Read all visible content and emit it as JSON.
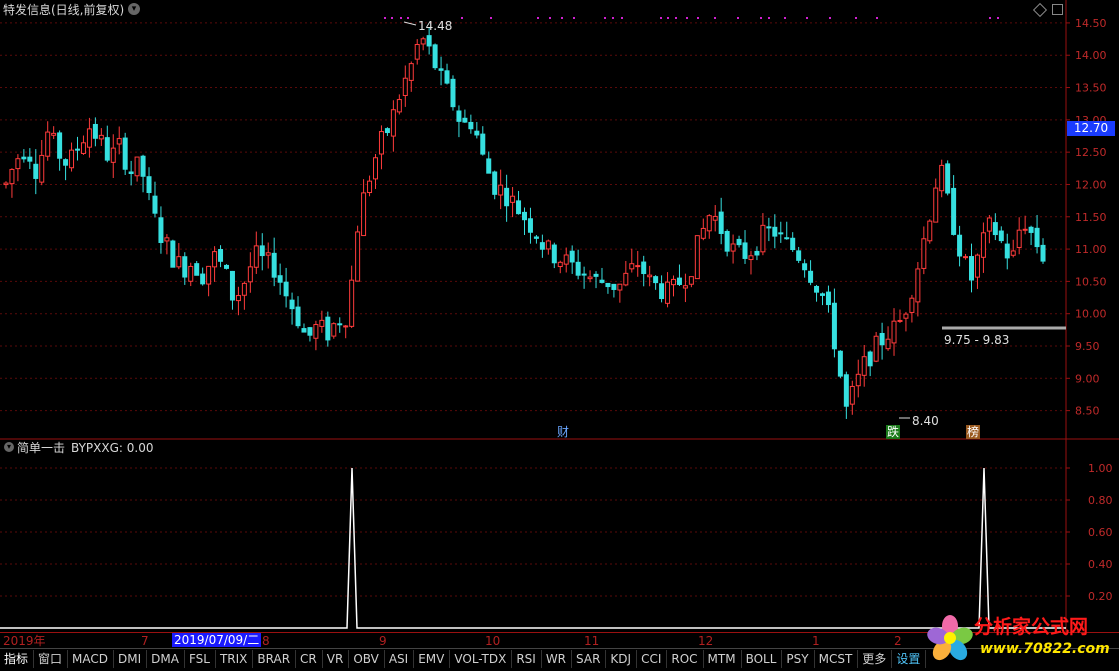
{
  "header": {
    "title": "特发信息(日线,前复权)",
    "mode_icon": "chevron-down-icon"
  },
  "corner_icons": [
    "diamond-icon",
    "square-icon"
  ],
  "main_chart": {
    "high_label": "14.48",
    "low_label": "8.40",
    "range_label": "9.75 - 9.83",
    "current_price": "12.70",
    "markers": [
      "财",
      "跌",
      "榜"
    ],
    "y_ticks": [
      "14.50",
      "14.00",
      "13.50",
      "13.00",
      "12.50",
      "12.00",
      "11.50",
      "11.00",
      "10.50",
      "10.00",
      "9.50",
      "9.00",
      "8.50"
    ]
  },
  "indicator": {
    "title": "简单一击",
    "value_label": "BYPXXG: 0.00",
    "y_ticks": [
      "1.00",
      "0.80",
      "0.60",
      "0.40",
      "0.20"
    ]
  },
  "date_axis": {
    "labels": [
      "2019年",
      "7",
      "2019/07/09/二",
      "8",
      "9",
      "10",
      "11",
      "12",
      "1",
      "2"
    ],
    "selected": "2019/07/09/二"
  },
  "toolbar": {
    "items": [
      "指标",
      "窗口",
      "MACD",
      "DMI",
      "DMA",
      "FSL",
      "TRIX",
      "BRAR",
      "CR",
      "VR",
      "OBV",
      "ASI",
      "EMV",
      "VOL-TDX",
      "RSI",
      "WR",
      "SAR",
      "KDJ",
      "CCI",
      "ROC",
      "MTM",
      "BOLL",
      "PSY",
      "MCST",
      "更多",
      "设置"
    ]
  },
  "watermark": {
    "site_name": "分析家公式网",
    "url": "www.70822.com"
  },
  "chart_data": [
    {
      "type": "candlestick",
      "title": "特发信息(日线,前复权)",
      "x_range": [
        "2019-06",
        "2020-02"
      ],
      "ylim": [
        8.2,
        14.7
      ],
      "y_ticks": [
        8.5,
        9.0,
        9.5,
        10.0,
        10.5,
        11.0,
        11.5,
        12.0,
        12.5,
        13.0,
        13.5,
        14.0,
        14.5
      ],
      "annotations": [
        {
          "label": "14.48",
          "value": 14.48,
          "kind": "high"
        },
        {
          "label": "8.40",
          "value": 8.4,
          "kind": "low"
        },
        {
          "label": "9.75 - 9.83",
          "value": [
            9.75,
            9.83
          ],
          "kind": "range"
        },
        {
          "label": "12.70",
          "value": 12.7,
          "kind": "price-tag"
        }
      ],
      "close_path": [
        12.0,
        12.4,
        12.6,
        12.2,
        12.8,
        12.5,
        12.3,
        12.6,
        12.9,
        12.7,
        12.4,
        12.6,
        12.2,
        12.3,
        11.6,
        11.2,
        10.9,
        10.7,
        10.8,
        10.6,
        10.9,
        10.7,
        10.2,
        10.5,
        10.9,
        10.8,
        10.7,
        10.3,
        10.0,
        9.6,
        9.8,
        9.7,
        9.9,
        10.0,
        11.5,
        12.1,
        12.6,
        12.9,
        13.4,
        13.8,
        14.3,
        14.0,
        13.6,
        13.3,
        12.9,
        13.0,
        12.4,
        12.0,
        11.9,
        11.7,
        11.5,
        11.3,
        11.0,
        10.9,
        10.8,
        10.7,
        10.6,
        10.5,
        10.5,
        10.4,
        10.6,
        10.8,
        10.5,
        10.4,
        10.3,
        10.5,
        10.7,
        11.2,
        11.6,
        11.3,
        11.0,
        10.9,
        11.0,
        11.2,
        11.3,
        11.1,
        11.0,
        10.8,
        10.5,
        10.2,
        9.5,
        8.5,
        8.9,
        9.3,
        9.5,
        9.7,
        9.8,
        10.2,
        10.8,
        11.5,
        12.3,
        11.6,
        11.0,
        10.5,
        11.0,
        11.4,
        11.1,
        10.8,
        11.5,
        11.2,
        10.9
      ]
    },
    {
      "type": "line",
      "title": "简单一击",
      "series": [
        {
          "name": "BYPXXG",
          "values": [
            0,
            1,
            0,
            1,
            0
          ]
        }
      ],
      "x": [
        "2019-08",
        "2019-08",
        "2019-09",
        "2020-02",
        "2020-02"
      ],
      "ylim": [
        0,
        1.05
      ],
      "y_ticks": [
        0.2,
        0.4,
        0.6,
        0.8,
        1.0
      ]
    }
  ]
}
